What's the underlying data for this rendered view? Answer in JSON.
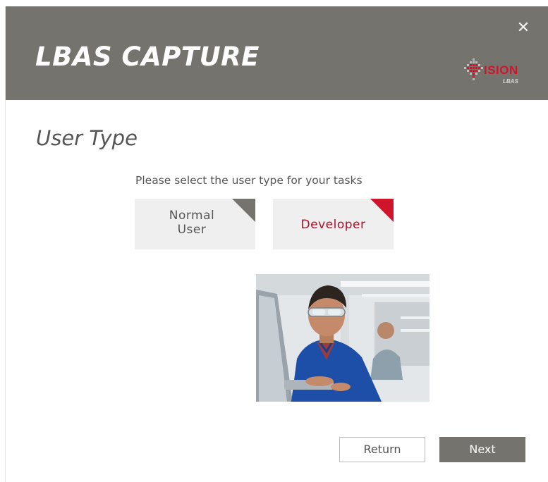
{
  "window": {
    "app_title": "LBAS CAPTURE",
    "close_glyph": "✕",
    "logo": {
      "word": "ISION",
      "sub": "LBAS",
      "icon": "vision-logo-icon"
    }
  },
  "page": {
    "title": "User Type",
    "instruction": "Please select the user type for your tasks"
  },
  "user_types": [
    {
      "label": "Normal\nUser",
      "selected": false
    },
    {
      "label": "Developer",
      "selected": true
    }
  ],
  "actions": {
    "return_label": "Return",
    "next_label": "Next"
  },
  "colors": {
    "header_bg": "#75736e",
    "accent_red": "#d0142c",
    "option_bg": "#efefef",
    "text_gray": "#555555"
  }
}
